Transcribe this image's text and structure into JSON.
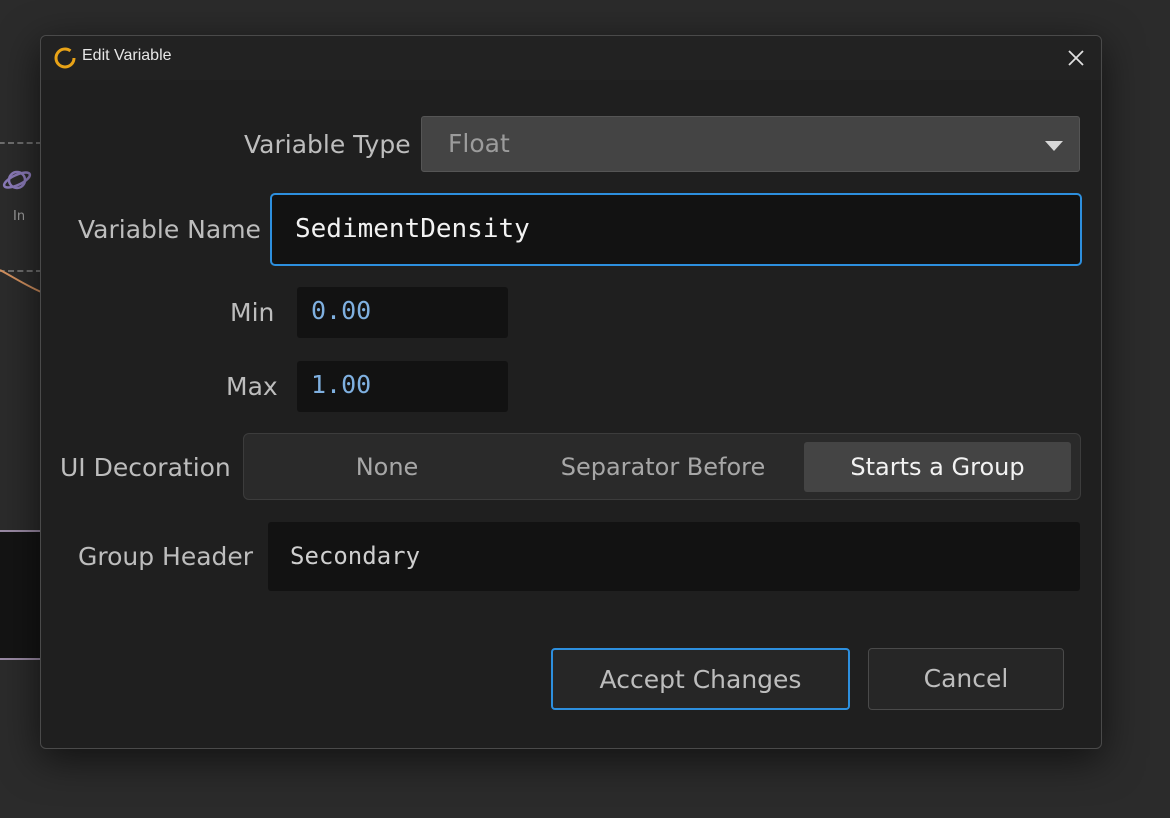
{
  "background": {
    "node_port_label": "In"
  },
  "dialog": {
    "title": "Edit Variable",
    "accent_color": "#2d8fde",
    "app_icon_color": "#e8a317",
    "fields": {
      "variable_type": {
        "label": "Variable Type",
        "value": "Float"
      },
      "variable_name": {
        "label": "Variable Name",
        "value": "SedimentDensity"
      },
      "min": {
        "label": "Min",
        "value": "0.00"
      },
      "max": {
        "label": "Max",
        "value": "1.00"
      },
      "ui_decoration": {
        "label": "UI Decoration",
        "options": [
          "None",
          "Separator Before",
          "Starts a Group"
        ],
        "selected": "Starts a Group"
      },
      "group_header": {
        "label": "Group Header",
        "value": "Secondary"
      }
    },
    "buttons": {
      "accept": "Accept Changes",
      "cancel": "Cancel"
    }
  }
}
